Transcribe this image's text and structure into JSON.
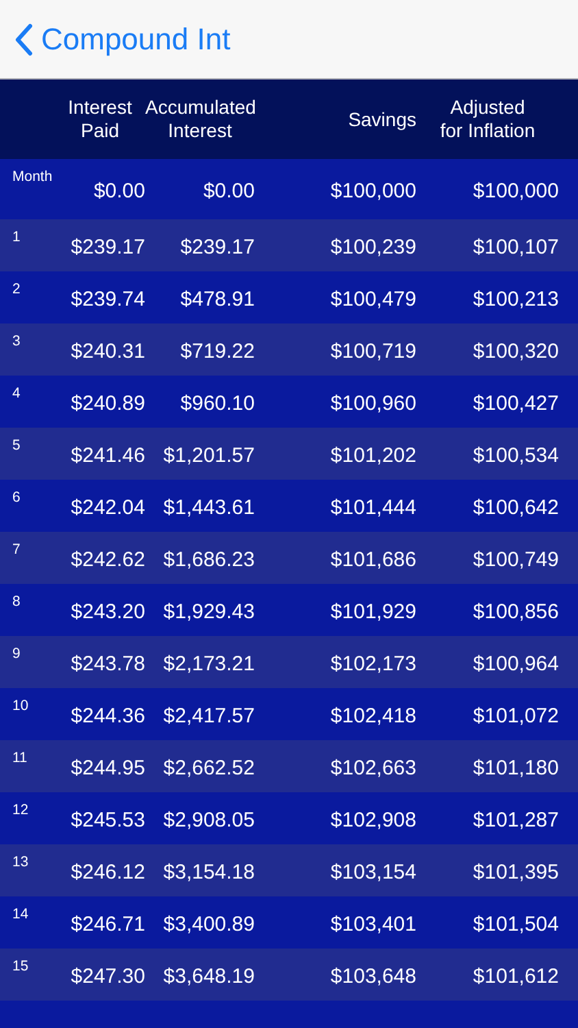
{
  "nav": {
    "title": "Compound Int"
  },
  "table": {
    "columns": [
      "Interest\nPaid",
      "Accumulated\nInterest",
      "Savings",
      "Adjusted\nfor Inflation"
    ],
    "rows": [
      {
        "label": "Month",
        "cells": [
          "$0.00",
          "$0.00",
          "$100,000",
          "$100,000"
        ]
      },
      {
        "label": "1",
        "cells": [
          "$239.17",
          "$239.17",
          "$100,239",
          "$100,107"
        ]
      },
      {
        "label": "2",
        "cells": [
          "$239.74",
          "$478.91",
          "$100,479",
          "$100,213"
        ]
      },
      {
        "label": "3",
        "cells": [
          "$240.31",
          "$719.22",
          "$100,719",
          "$100,320"
        ]
      },
      {
        "label": "4",
        "cells": [
          "$240.89",
          "$960.10",
          "$100,960",
          "$100,427"
        ]
      },
      {
        "label": "5",
        "cells": [
          "$241.46",
          "$1,201.57",
          "$101,202",
          "$100,534"
        ]
      },
      {
        "label": "6",
        "cells": [
          "$242.04",
          "$1,443.61",
          "$101,444",
          "$100,642"
        ]
      },
      {
        "label": "7",
        "cells": [
          "$242.62",
          "$1,686.23",
          "$101,686",
          "$100,749"
        ]
      },
      {
        "label": "8",
        "cells": [
          "$243.20",
          "$1,929.43",
          "$101,929",
          "$100,856"
        ]
      },
      {
        "label": "9",
        "cells": [
          "$243.78",
          "$2,173.21",
          "$102,173",
          "$100,964"
        ]
      },
      {
        "label": "10",
        "cells": [
          "$244.36",
          "$2,417.57",
          "$102,418",
          "$101,072"
        ]
      },
      {
        "label": "11",
        "cells": [
          "$244.95",
          "$2,662.52",
          "$102,663",
          "$101,180"
        ]
      },
      {
        "label": "12",
        "cells": [
          "$245.53",
          "$2,908.05",
          "$102,908",
          "$101,287"
        ]
      },
      {
        "label": "13",
        "cells": [
          "$246.12",
          "$3,154.18",
          "$103,154",
          "$101,395"
        ]
      },
      {
        "label": "14",
        "cells": [
          "$246.71",
          "$3,400.89",
          "$103,401",
          "$101,504"
        ]
      },
      {
        "label": "15",
        "cells": [
          "$247.30",
          "$3,648.19",
          "$103,648",
          "$101,612"
        ]
      }
    ]
  }
}
